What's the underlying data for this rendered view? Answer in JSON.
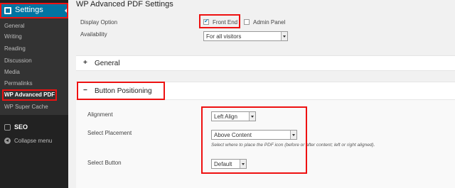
{
  "sidebar": {
    "settings_label": "Settings",
    "items": [
      {
        "label": "General"
      },
      {
        "label": "Writing"
      },
      {
        "label": "Reading"
      },
      {
        "label": "Discussion"
      },
      {
        "label": "Media"
      },
      {
        "label": "Permalinks"
      },
      {
        "label": "WP Advanced PDF"
      },
      {
        "label": "WP Super Cache"
      }
    ],
    "seo_label": "SEO",
    "collapse_label": "Collapse menu"
  },
  "main": {
    "page_title": "WP Advanced PDF Settings",
    "display_option": {
      "label": "Display Option",
      "front_end": "Front End",
      "admin_panel": "Admin Panel",
      "front_end_checked": true,
      "admin_panel_checked": false
    },
    "availability": {
      "label": "Availability",
      "value": "For all visitors"
    },
    "panels": {
      "general": {
        "toggle": "+",
        "title": "General"
      },
      "button_positioning": {
        "toggle": "−",
        "title": "Button Positioning"
      }
    },
    "alignment": {
      "label": "Alignment",
      "value": "Left Align"
    },
    "placement": {
      "label": "Select Placement",
      "value": "Above Content",
      "help": "Select where to place the PDF icon (before or after content; left or right aligned)."
    },
    "button": {
      "label": "Select Button",
      "value": "Default"
    }
  },
  "colors": {
    "accent": "#0074a2",
    "highlight": "#e11111"
  }
}
